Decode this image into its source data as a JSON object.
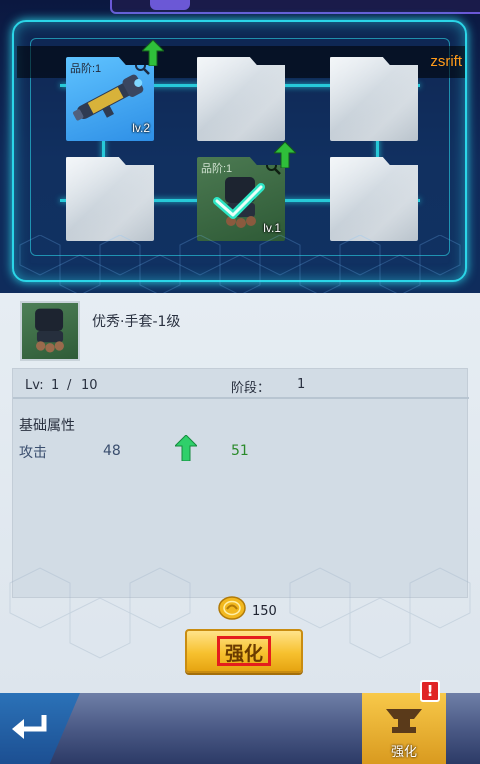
{
  "user": {
    "name": "zsrift"
  },
  "slots": [
    {
      "grade_label": "品阶:1",
      "level": "lv.2",
      "item": "rocket-launcher"
    },
    {
      "grade_label": "",
      "level": "",
      "item": "empty"
    },
    {
      "grade_label": "",
      "level": "",
      "item": "empty"
    },
    {
      "grade_label": "",
      "level": "",
      "item": "empty"
    },
    {
      "grade_label": "品阶:1",
      "level": "lv.1",
      "item": "gloves"
    },
    {
      "grade_label": "",
      "level": "",
      "item": "empty"
    }
  ],
  "detail": {
    "item_name": "优秀·手套-1级",
    "lv_label": "Lv:",
    "lv_current": "1",
    "lv_sep": "/",
    "lv_max": "10",
    "stage_label": "阶段：",
    "stage_value": "1",
    "base_attrs_title": "基础属性",
    "attr_name": "攻击",
    "attr_current": "48",
    "attr_next": "51"
  },
  "enhance": {
    "cost": "150",
    "button_label": "强化"
  },
  "bottom_bar": {
    "tab_enhance_label": "强化",
    "alert": "!"
  },
  "colors": {
    "frame_glow": "#2bd6e8",
    "username": "#ff9b1a",
    "next_value": "#2a8a2a",
    "button_gold": "#f7c12f",
    "highlight_red": "#e41d1d"
  }
}
